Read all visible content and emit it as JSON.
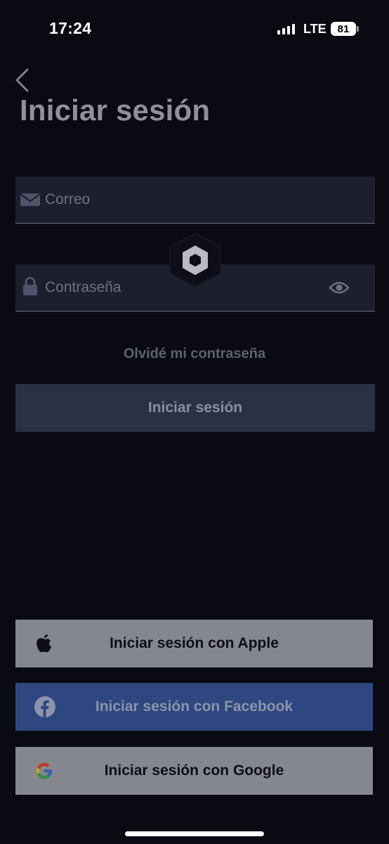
{
  "status_bar": {
    "time": "17:24",
    "network": "LTE",
    "battery": "81"
  },
  "header": {
    "title": "Iniciar sesión",
    "back_icon": "chevron-left-icon"
  },
  "form": {
    "email_placeholder": "Correo",
    "email_icon": "mail-icon",
    "password_placeholder": "Contraseña",
    "password_icon": "lock-icon",
    "show_password_icon": "eye-icon",
    "forgot_password": "Olvidé mi contraseña",
    "submit_label": "Iniciar sesión"
  },
  "social": {
    "apple_label": "Iniciar sesión con Apple",
    "facebook_label": "Iniciar sesión con Facebook",
    "google_label": "Iniciar sesión con Google"
  },
  "colors": {
    "background": "#090a12",
    "field": "#1d1f2e",
    "primary_button": "#2a3145",
    "facebook": "#2e4780",
    "social_light": "#85878f"
  }
}
